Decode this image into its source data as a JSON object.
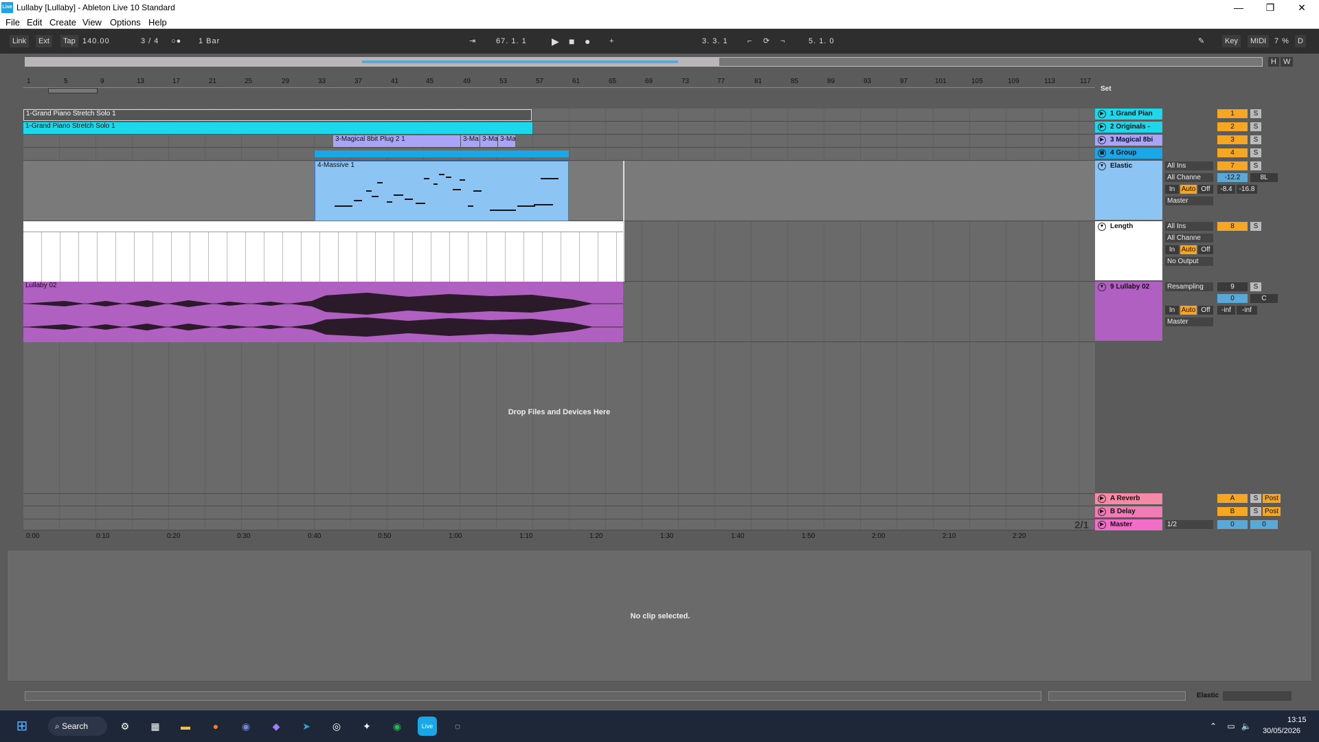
{
  "window": {
    "title": "Lullaby  [Lullaby] - Ableton Live 10 Standard",
    "logo_text": "Live",
    "minimize": "—",
    "maximize": "❐",
    "close": "✕"
  },
  "menu": [
    "File",
    "Edit",
    "Create",
    "View",
    "Options",
    "Help"
  ],
  "transport": {
    "link": "Link",
    "ext": "Ext",
    "tap": "Tap",
    "tempo": "140.00",
    "signature": "3 / 4",
    "quantize": "1 Bar",
    "position": "67.  1.  1",
    "loop_start": "3.   3.   1",
    "loop_length": "5.   1.   0",
    "key": "Key",
    "midi": "MIDI",
    "cpu": "7 %",
    "d": "D",
    "h": "H",
    "w": "W"
  },
  "ruler_ticks": [
    "1",
    "5",
    "9",
    "13",
    "17",
    "21",
    "25",
    "29",
    "33",
    "37",
    "41",
    "45",
    "49",
    "53",
    "57",
    "61",
    "65",
    "69",
    "73",
    "77",
    "81",
    "85",
    "89",
    "93",
    "97",
    "101",
    "105",
    "109",
    "113",
    "117"
  ],
  "time_ticks": [
    "0:00",
    "0:10",
    "0:20",
    "0:30",
    "0:40",
    "0:50",
    "1:00",
    "1:10",
    "1:20",
    "1:30",
    "1:40",
    "1:50",
    "2:00",
    "2:10",
    "2:20"
  ],
  "clips": {
    "grand_piano_1": "1-Grand Piano Stretch Solo 1",
    "grand_piano_2": "1-Grand Piano Stretch Solo 1",
    "magical": "3-Magical 8bit Plug 2 1",
    "magical_b": "3-Ma",
    "magical_c": "3-Ma",
    "magical_d": "3-Ma",
    "massive": "4-Massive 1",
    "lullaby": "Lullaby 02"
  },
  "drop_text": "Drop Files and Devices Here",
  "set_label": "Set",
  "zoom_label": "2/1",
  "tracks": [
    {
      "name": "1 Grand Pian",
      "num": "1",
      "color": "#1bd8ea"
    },
    {
      "name": "2 Originals -",
      "num": "2",
      "color": "#1bd8ea"
    },
    {
      "name": "3 Magical 8bi",
      "num": "3",
      "color": "#a8a5f8"
    },
    {
      "name": "4 Group",
      "num": "4",
      "color": "#1aa7e8"
    }
  ],
  "track_elastic": {
    "name": "Elastic",
    "input": "All Ins",
    "channel": "All Channe",
    "in": "In",
    "auto": "Auto",
    "off": "Off",
    "output": "Master",
    "num": "7",
    "vol": "-12.2",
    "pan": "8L",
    "meter_l": "-8.4",
    "meter_r": "-16.8"
  },
  "track_length": {
    "name": "Length",
    "input": "All Ins",
    "channel": "All Channe",
    "in": "In",
    "auto": "Auto",
    "off": "Off",
    "output": "No Output",
    "num": "8"
  },
  "track_lullaby": {
    "name": "9 Lullaby 02",
    "input": "Resampling",
    "in": "In",
    "auto": "Auto",
    "off": "Off",
    "output": "Master",
    "num": "9",
    "vol": "0",
    "pan": "C",
    "meter_l": "-inf",
    "meter_r": "-inf"
  },
  "returns": [
    {
      "name": "A Reverb",
      "num": "A",
      "post": "Post",
      "color": "#f58aa6"
    },
    {
      "name": "B Delay",
      "num": "B",
      "post": "Post",
      "color": "#f07bb5"
    }
  ],
  "master": {
    "name": "Master",
    "cue": "1/2",
    "vol": "0",
    "pan": "0",
    "color": "#f06ec8"
  },
  "solo_label": "S",
  "detail_message": "No clip selected.",
  "status": {
    "label": "Elastic"
  },
  "taskbar": {
    "search": "Search",
    "time": "13:15",
    "date": "30/05/2026"
  },
  "colors": {
    "cyan": "#1bd8ea",
    "purple": "#b060c0",
    "blue": "#8cc4f4",
    "orange": "#f5a623"
  }
}
